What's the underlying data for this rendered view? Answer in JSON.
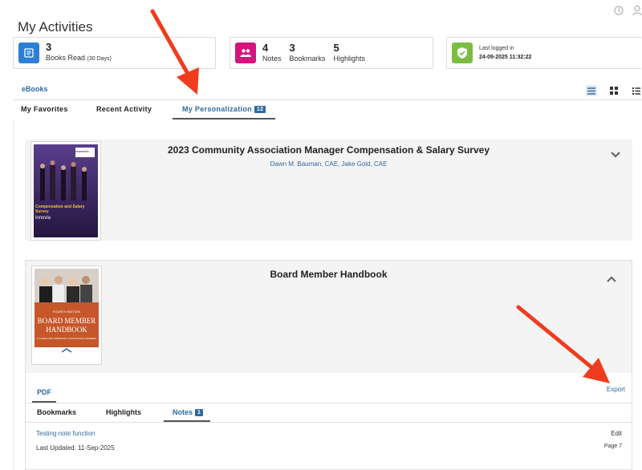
{
  "page": {
    "title": "My Activities"
  },
  "stats": {
    "books": {
      "count": "3",
      "label": "Books Read",
      "sub": "(30 Days)",
      "color": "#2b7fd4"
    },
    "activity": {
      "color": "#d4147c",
      "notes": {
        "count": "4",
        "label": "Notes"
      },
      "bookmarks": {
        "count": "3",
        "label": "Bookmarks"
      },
      "highlights": {
        "count": "5",
        "label": "Highlights"
      }
    },
    "login": {
      "label": "Last logged in",
      "value": "24-09-2025 11:32:22",
      "color": "#7bbd42"
    }
  },
  "section": {
    "label": "eBooks"
  },
  "tabs": {
    "favorites": "My Favorites",
    "recent": "Recent Activity",
    "personalization": "My Personalization",
    "personalization_count": "12"
  },
  "books": [
    {
      "title": "2023 Community Association Manager Compensation & Salary Survey",
      "authors": "Dawn M. Bauman, CAE, Jake Gold, CAE",
      "cover": {
        "line1": "Compensation and Salary Survey",
        "brand": "innovia",
        "corner": "research"
      }
    },
    {
      "title": "Board Member Handbook",
      "cover": {
        "edition": "FOURTH EDITION",
        "line1": "BOARD MEMBER",
        "line2": "HANDBOOK",
        "sub": "A GUIDE FOR COMMUNITY ASSOCIATION LEADERS"
      },
      "format_tab": "PDF",
      "export": "Export",
      "subtabs": {
        "bookmarks": "Bookmarks",
        "highlights": "Highlights",
        "notes": "Notes",
        "notes_count": "1"
      },
      "note": {
        "title": "Testing note function",
        "edit": "Edit",
        "updated": "Last Updated: 11-Sep-2025",
        "page": "Page 7"
      }
    }
  ],
  "colors": {
    "accent": "#2e6aa0",
    "annotation_arrow": "#f03c1e"
  }
}
